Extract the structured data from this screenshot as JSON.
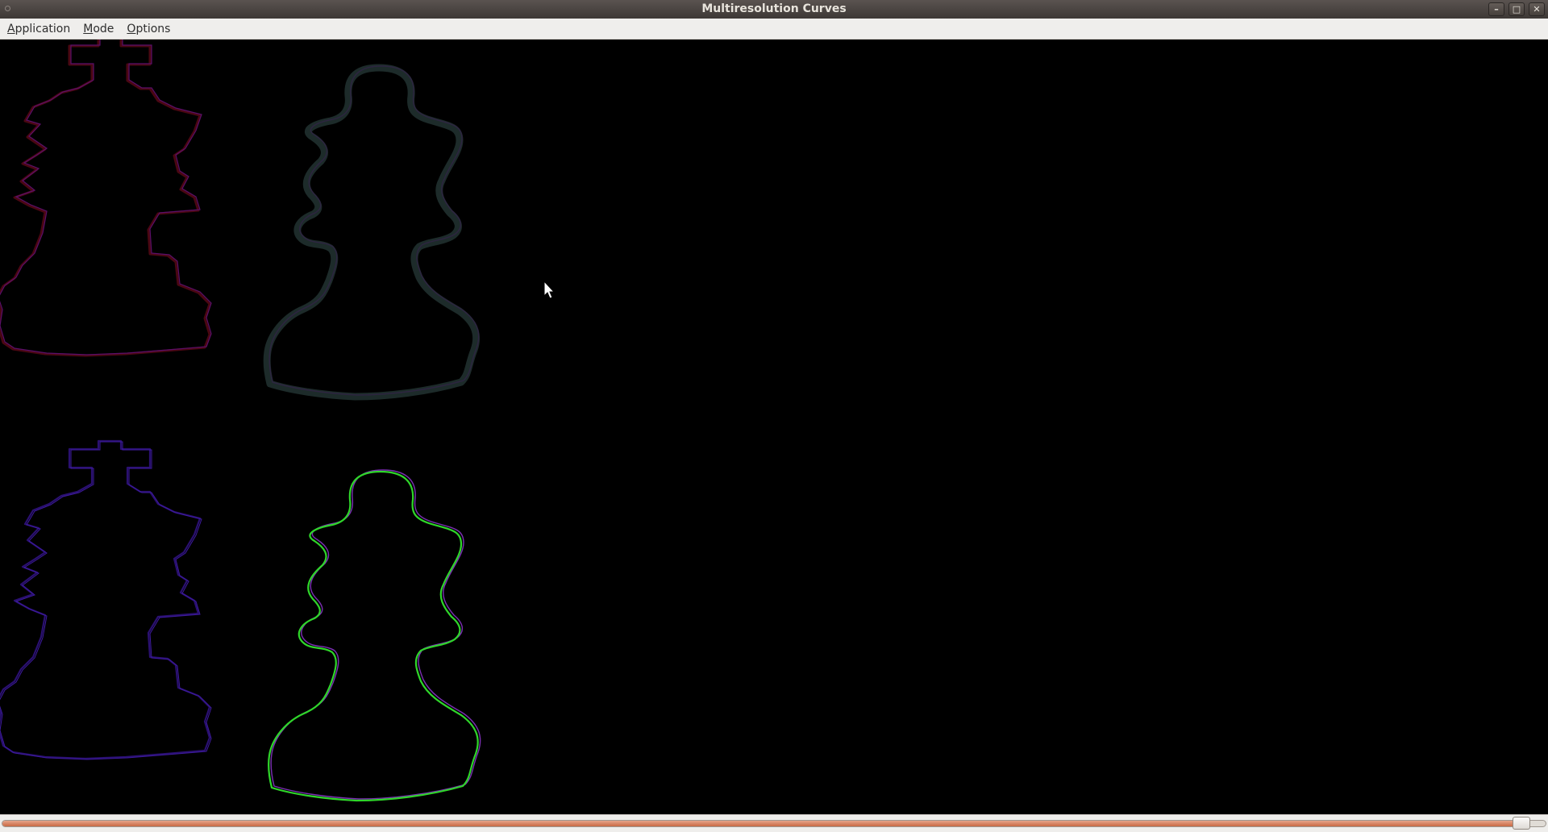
{
  "window": {
    "title": "Multiresolution Curves",
    "buttons": {
      "minimize": "–",
      "maximize": "□",
      "close": "✕"
    }
  },
  "menubar": {
    "items": [
      {
        "mnemonic": "A",
        "rest": "pplication"
      },
      {
        "mnemonic": "M",
        "rest": "ode"
      },
      {
        "mnemonic": "O",
        "rest": "ptions"
      }
    ]
  },
  "canvas": {
    "background": "#000000",
    "panels": [
      {
        "name": "top-left",
        "colors": [
          "#4a0712",
          "#5b0f6a"
        ]
      },
      {
        "name": "top-right",
        "colors": [
          "#1d2b2a",
          "#2d2540"
        ]
      },
      {
        "name": "bottom-left",
        "colors": [
          "#2a1070",
          "#3e1ba0"
        ]
      },
      {
        "name": "bottom-right",
        "colors": [
          "#2fd62a",
          "#7b2fb3"
        ]
      }
    ]
  },
  "slider": {
    "level_fraction": 0.99,
    "fill_color": "#c96a44"
  },
  "colors": {
    "titlebar": "#3d3835",
    "menubar": "#efeeec",
    "accent": "#c96a44"
  }
}
